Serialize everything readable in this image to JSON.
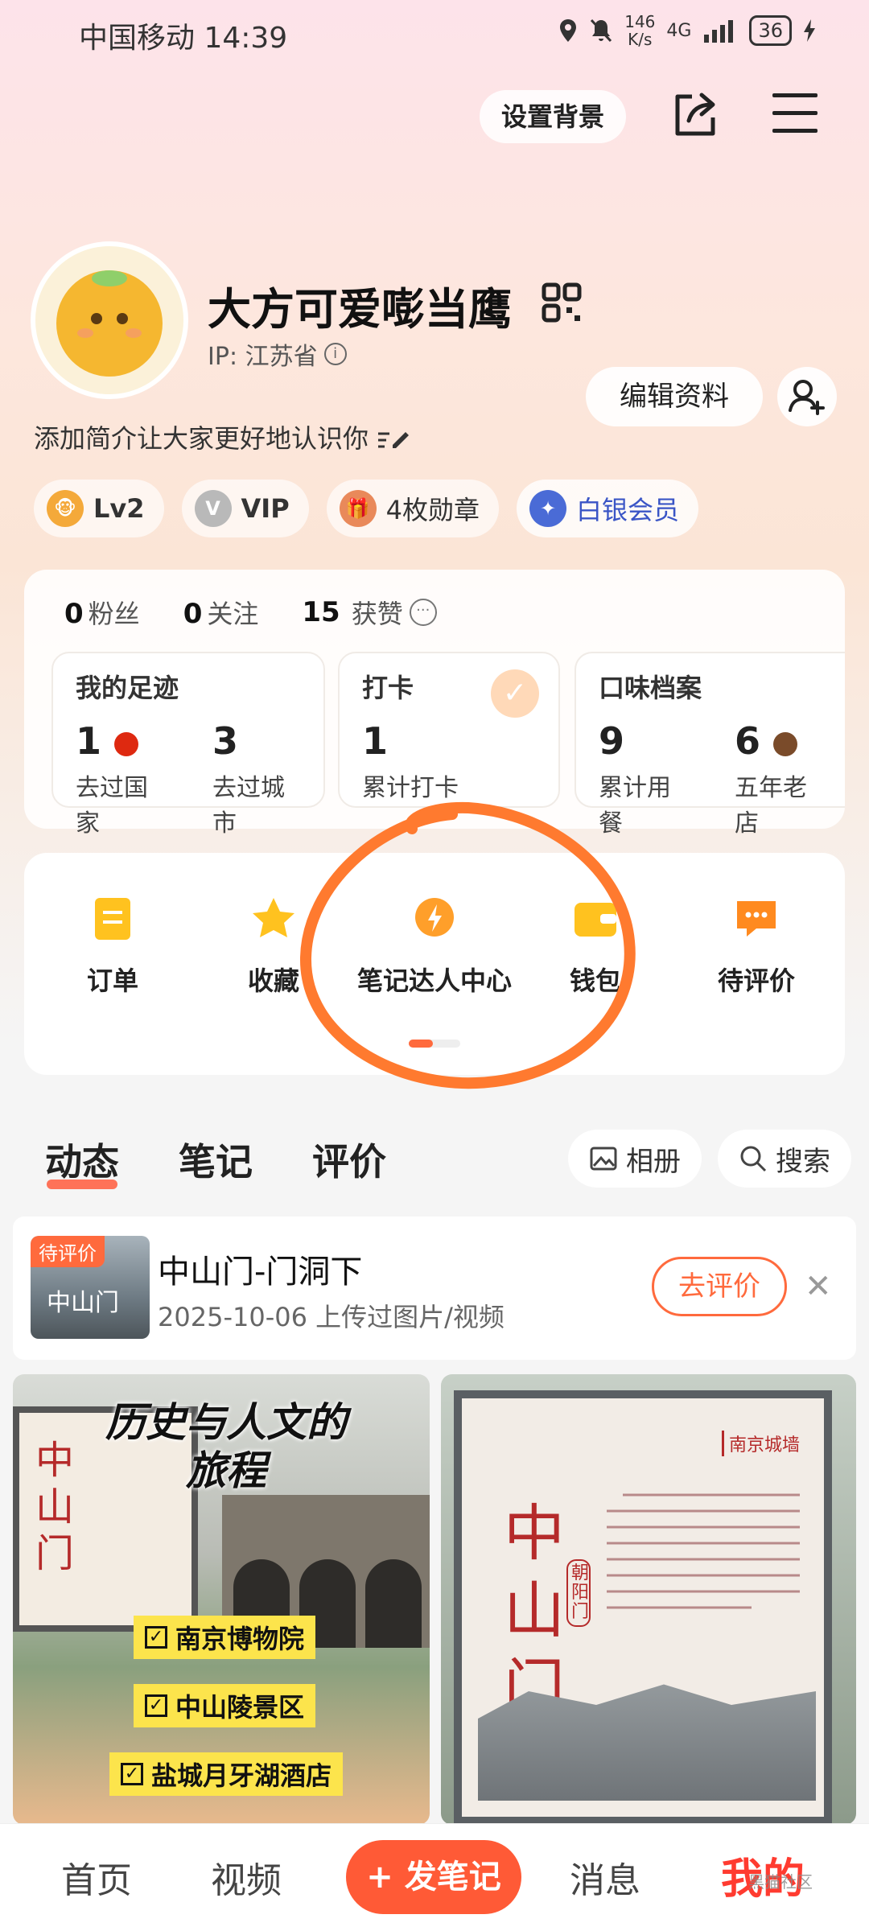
{
  "status_bar": {
    "carrier_time": "中国移动 14:39",
    "speed_value": "146",
    "speed_unit": "K/s",
    "network": "4G",
    "battery": "36"
  },
  "header": {
    "set_background": "设置背景",
    "icons": [
      "share-icon",
      "menu-icon"
    ]
  },
  "profile": {
    "nickname": "大方可爱嘭当鹰",
    "ip": "IP: 江苏省",
    "edit_button": "编辑资料",
    "bio": "添加简介让大家更好地认识你",
    "badges": [
      {
        "label": "Lv2",
        "icon": "level-icon"
      },
      {
        "label": "VIP",
        "icon": "vip-icon"
      },
      {
        "label": "4枚勋章",
        "icon": "medal-icon"
      },
      {
        "label": "白银会员",
        "icon": "silver-member-icon"
      }
    ]
  },
  "stats": {
    "fans_count": "0",
    "fans_label": "粉丝",
    "following_count": "0",
    "following_label": "关注",
    "likes_count": "15",
    "likes_label": "获赞"
  },
  "cards": {
    "footprint": {
      "title": "我的足迹",
      "countries_value": "1",
      "countries_label": "去过国家",
      "cities_value": "3",
      "cities_label": "去过城市"
    },
    "checkin": {
      "title": "打卡",
      "value": "1",
      "label": "累计打卡"
    },
    "taste": {
      "title": "口味档案",
      "meals_value": "9",
      "meals_label": "累计用餐",
      "years_value": "6",
      "years_label": "五年老店"
    }
  },
  "quick_menu": {
    "items": [
      {
        "label": "订单",
        "icon": "order-icon"
      },
      {
        "label": "收藏",
        "icon": "star-icon"
      },
      {
        "label": "笔记达人中心",
        "icon": "lightning-icon"
      },
      {
        "label": "钱包",
        "icon": "wallet-icon"
      },
      {
        "label": "待评价",
        "icon": "comment-icon"
      }
    ]
  },
  "content_tabs": {
    "tabs": [
      "动态",
      "笔记",
      "评价"
    ],
    "active": "动态",
    "album": "相册",
    "search": "搜索"
  },
  "review_card": {
    "tag": "待评价",
    "thumb_text": "中山门",
    "title": "中山门-门洞下",
    "subtitle": "2025-10-06 上传过图片/视频",
    "button": "去评价"
  },
  "photos": {
    "left_title": "历史与人文的旅程",
    "left_board": "中山门",
    "checks": [
      "南京博物院",
      "中山陵景区",
      "盐城月牙湖酒店"
    ],
    "right_board_title": "中山门",
    "right_board_sub": "朝阳门",
    "right_logo": "南京城墙"
  },
  "bottom_nav": {
    "home": "首页",
    "video": "视频",
    "post": "+ 发笔记",
    "messages": "消息",
    "me": "我的",
    "watermark": "黑猫社区"
  },
  "colors": {
    "accent": "#ff5a36",
    "annotation_circle": "#ff7a2f",
    "silver_member": "#3a55c6"
  }
}
